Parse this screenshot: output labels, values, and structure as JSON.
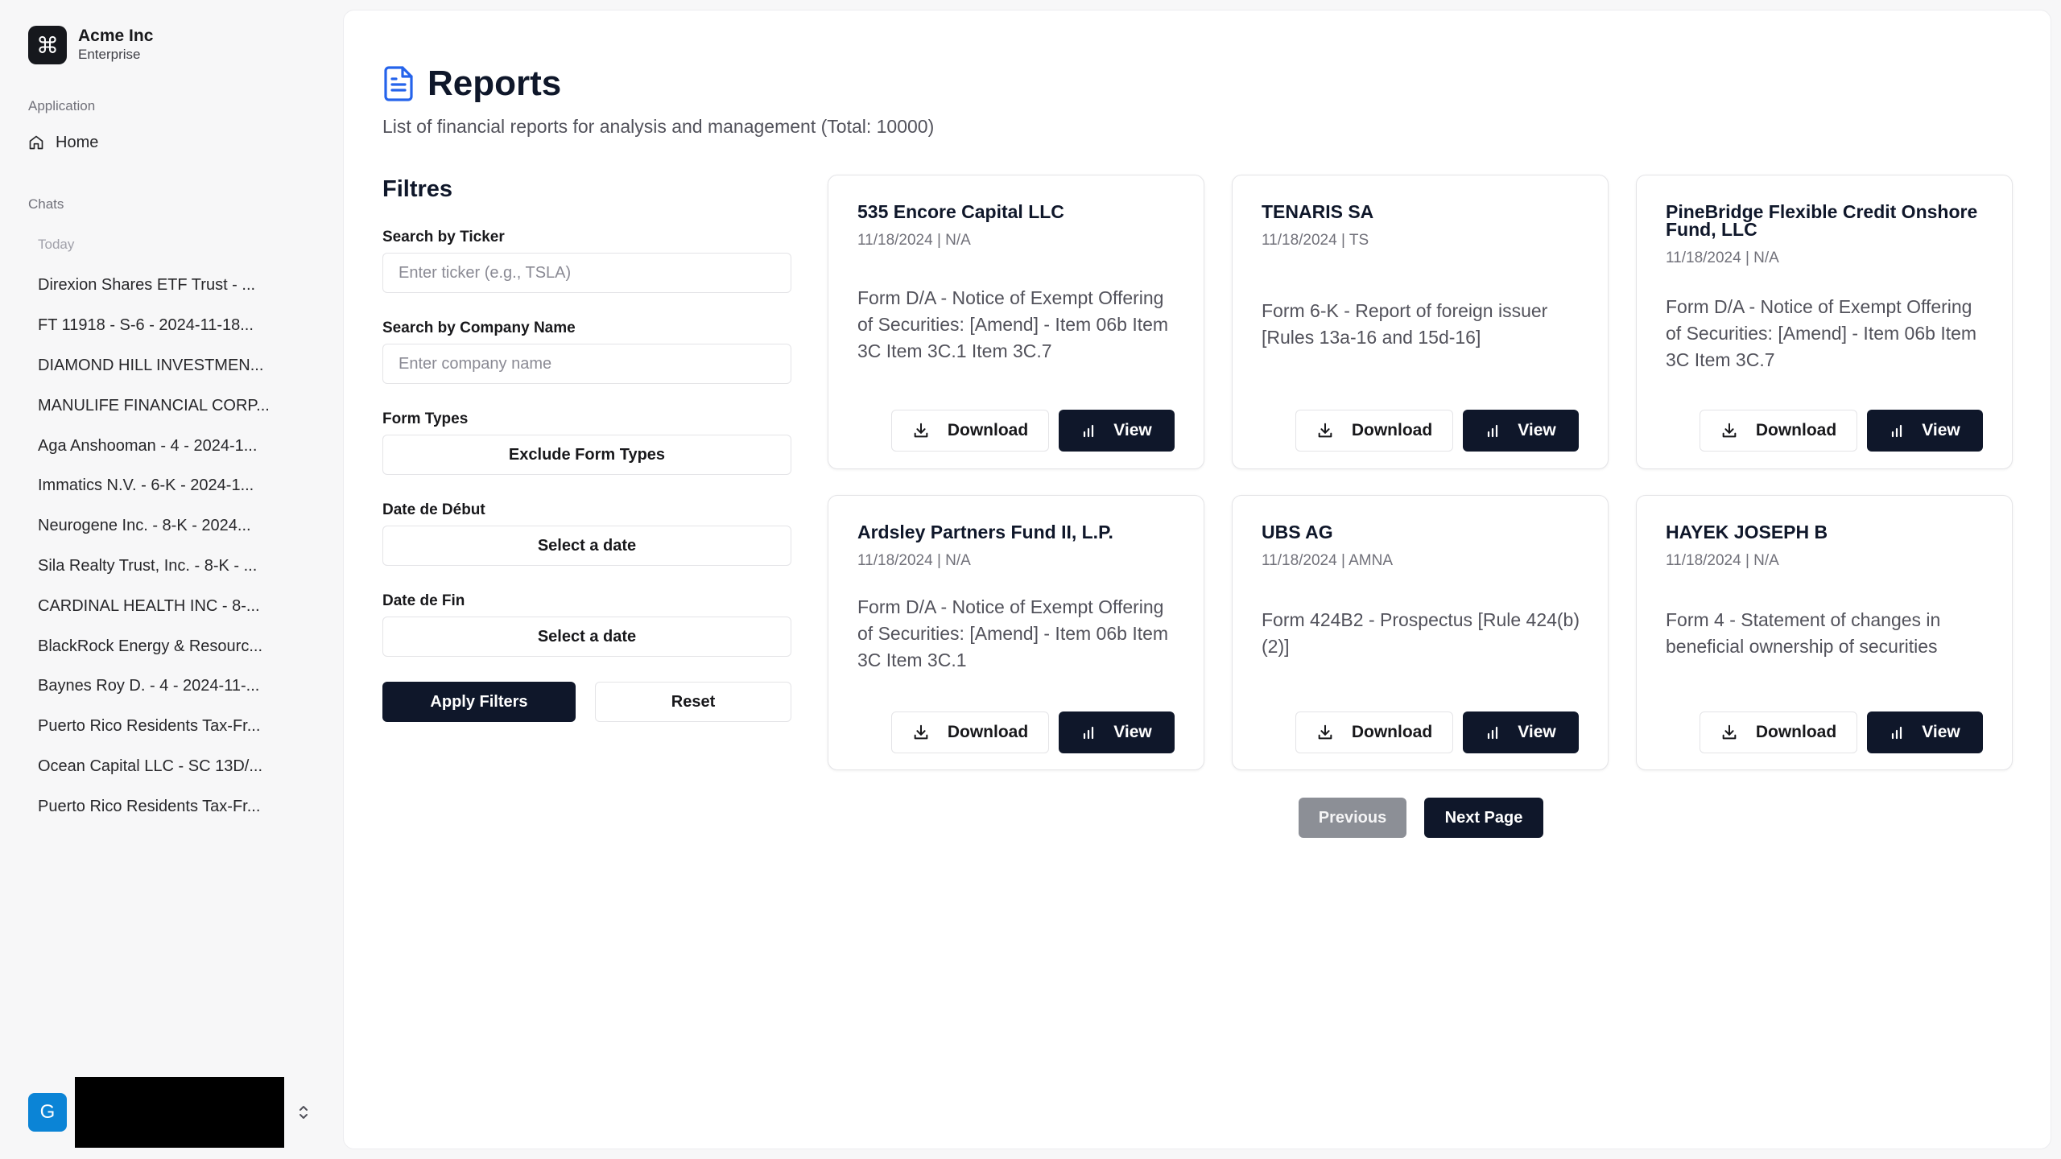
{
  "sidebar": {
    "brand": {
      "name": "Acme Inc",
      "plan": "Enterprise",
      "logo_glyph": "⌘"
    },
    "application_label": "Application",
    "home_label": "Home",
    "chats_label": "Chats",
    "today_label": "Today",
    "chats": [
      {
        "label": "Direxion Shares ETF Trust - ..."
      },
      {
        "label": "FT 11918 - S-6 - 2024-11-18..."
      },
      {
        "label": "DIAMOND HILL INVESTMEN..."
      },
      {
        "label": "MANULIFE FINANCIAL CORP..."
      },
      {
        "label": "Aga Anshooman - 4 - 2024-1..."
      },
      {
        "label": "Immatics N.V. - 6-K - 2024-1..."
      },
      {
        "label": "Neurogene Inc. - 8-K - 2024..."
      },
      {
        "label": "Sila Realty Trust, Inc. - 8-K - ..."
      },
      {
        "label": "CARDINAL HEALTH INC - 8-..."
      },
      {
        "label": "BlackRock Energy & Resourc..."
      },
      {
        "label": "Baynes Roy D. - 4 - 2024-11-..."
      },
      {
        "label": "Puerto Rico Residents Tax-Fr..."
      },
      {
        "label": "Ocean Capital LLC - SC 13D/..."
      },
      {
        "label": "Puerto Rico Residents Tax-Fr..."
      }
    ],
    "user": {
      "avatar_letter": "G",
      "avatar_color": "#0b84d6"
    }
  },
  "header": {
    "title": "Reports",
    "subtitle": "List of financial reports for analysis and management (Total: 10000)"
  },
  "filters": {
    "title": "Filtres",
    "ticker_label": "Search by Ticker",
    "ticker_placeholder": "Enter ticker (e.g., TSLA)",
    "company_label": "Search by Company Name",
    "company_placeholder": "Enter company name",
    "form_types_label": "Form Types",
    "form_types_button": "Exclude Form Types",
    "start_date_label": "Date de Début",
    "start_date_button": "Select a date",
    "end_date_label": "Date de Fin",
    "end_date_button": "Select a date",
    "apply_label": "Apply Filters",
    "reset_label": "Reset"
  },
  "reports": [
    {
      "name": "535 Encore Capital LLC",
      "meta": "11/18/2024 | N/A",
      "description": "Form D/A - Notice of Exempt Offering of Securities: [Amend] - Item 06b Item 3C Item 3C.1 Item 3C.7",
      "download_label": "Download",
      "view_label": "View"
    },
    {
      "name": "TENARIS SA",
      "meta": "11/18/2024 | TS",
      "description": "Form 6-K - Report of foreign issuer [Rules 13a-16 and 15d-16]",
      "download_label": "Download",
      "view_label": "View"
    },
    {
      "name": "PineBridge Flexible Credit Onshore Fund, LLC",
      "meta": "11/18/2024 | N/A",
      "description": "Form D/A - Notice of Exempt Offering of Securities: [Amend] - Item 06b Item 3C Item 3C.7",
      "download_label": "Download",
      "view_label": "View"
    },
    {
      "name": "Ardsley Partners Fund II, L.P.",
      "meta": "11/18/2024 | N/A",
      "description": "Form D/A - Notice of Exempt Offering of Securities: [Amend] - Item 06b Item 3C Item 3C.1",
      "download_label": "Download",
      "view_label": "View"
    },
    {
      "name": "UBS AG",
      "meta": "11/18/2024 | AMNA",
      "description": "Form 424B2 - Prospectus [Rule 424(b)(2)]",
      "download_label": "Download",
      "view_label": "View"
    },
    {
      "name": "HAYEK JOSEPH B",
      "meta": "11/18/2024 | N/A",
      "description": "Form 4 - Statement of changes in beneficial ownership of securities",
      "download_label": "Download",
      "view_label": "View"
    }
  ],
  "pagination": {
    "previous_label": "Previous",
    "next_label": "Next Page"
  },
  "colors": {
    "accent": "#0f172a",
    "title_icon": "#2563eb",
    "disabled": "#8c8f96"
  }
}
